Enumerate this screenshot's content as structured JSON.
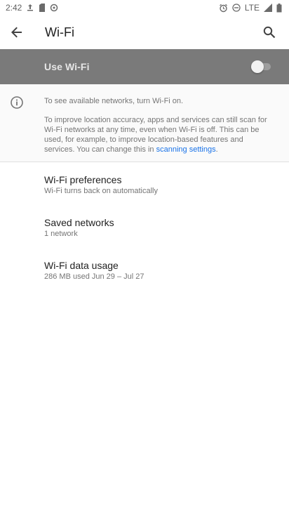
{
  "status_bar": {
    "time": "2:42",
    "network": "LTE"
  },
  "appbar": {
    "title": "Wi-Fi"
  },
  "master_switch": {
    "label": "Use Wi-Fi",
    "checked": false
  },
  "info": {
    "line1": "To see available networks, turn Wi-Fi on.",
    "body": "To improve location accuracy, apps and services can still scan for Wi-Fi networks at any time, even when Wi-Fi is off. This can be used, for example, to improve location-based features and services. You can change this in ",
    "link": "scanning settings",
    "suffix": "."
  },
  "preferences": [
    {
      "title": "Wi-Fi preferences",
      "summary": "Wi-Fi turns back on automatically"
    },
    {
      "title": "Saved networks",
      "summary": "1 network"
    },
    {
      "title": "Wi-Fi data usage",
      "summary": "286 MB used Jun 29 – Jul 27"
    }
  ],
  "colors": {
    "master_bg": "#7a7a7a",
    "link": "#1a73e8"
  }
}
